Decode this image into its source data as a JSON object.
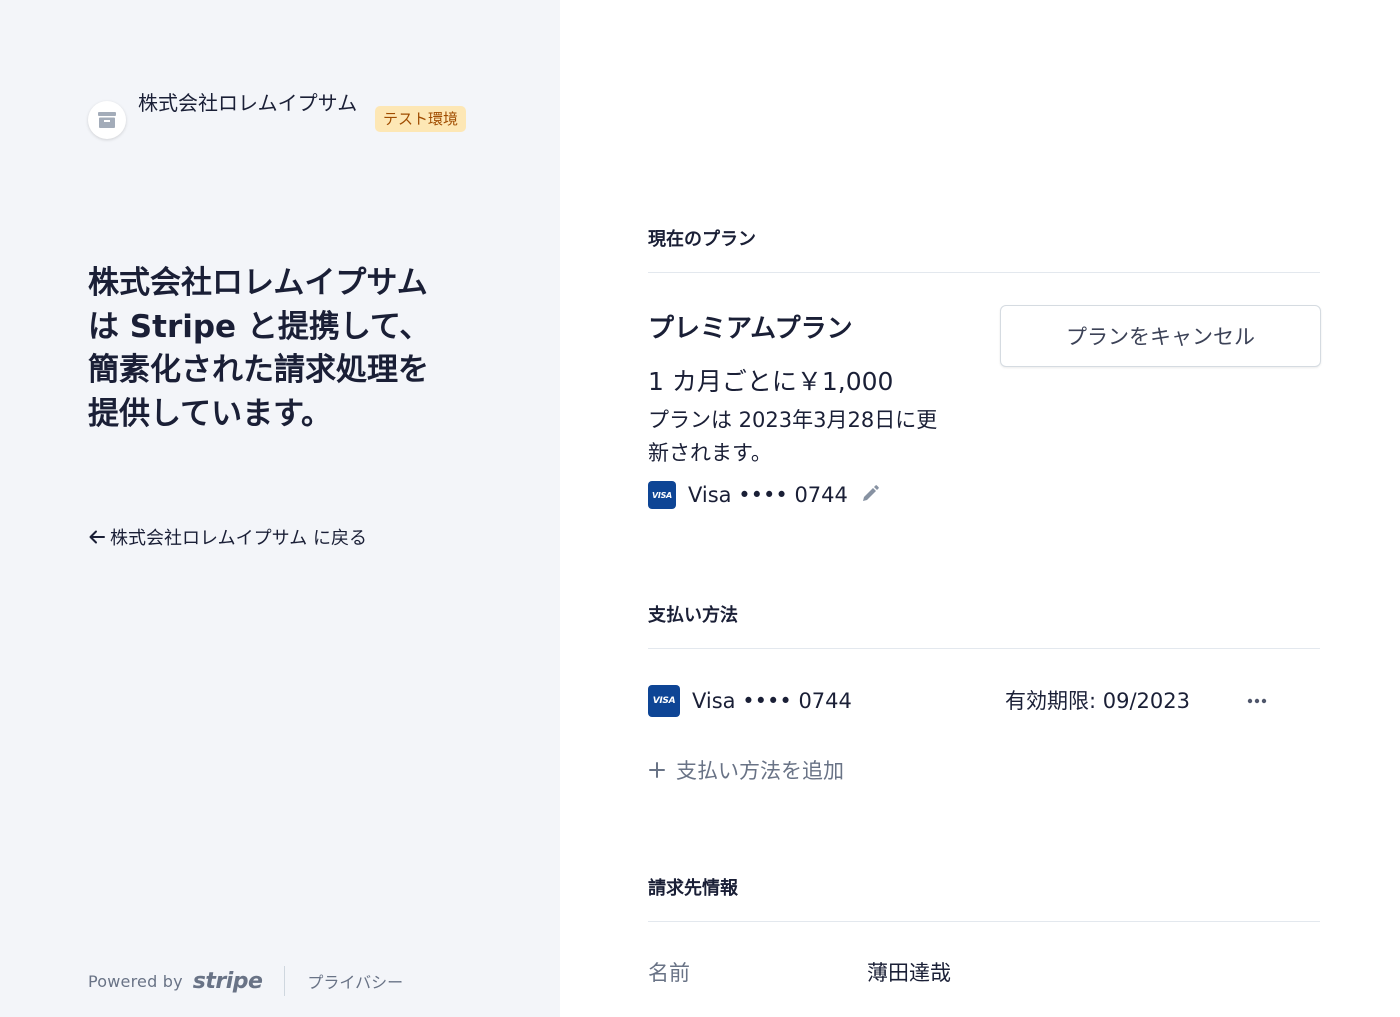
{
  "brand": {
    "name": "株式会社ロレムイプサム",
    "badge": "テスト環境"
  },
  "headline": "株式会社ロレムイプサム は Stripe と提携して、簡素化された請求処理を提供しています。",
  "back_link": "株式会社ロレムイプサム に戻る",
  "footer": {
    "powered_by": "Powered by",
    "stripe": "stripe",
    "privacy": "プライバシー"
  },
  "current_plan": {
    "section_title": "現在のプラン",
    "plan_name": "プレミアムプラン",
    "price": "1 カ月ごとに￥1,000",
    "renewal": "プランは 2023年3月28日に更新されます。",
    "card_brand_badge": "VISA",
    "card": "Visa •••• 0744",
    "cancel_button": "プランをキャンセル"
  },
  "payment_methods": {
    "section_title": "支払い方法",
    "items": [
      {
        "brand_badge": "VISA",
        "card": "Visa •••• 0744",
        "expiry": "有効期限: 09/2023"
      }
    ],
    "add_label": "支払い方法を追加"
  },
  "billing_info": {
    "section_title": "請求先情報",
    "name_label": "名前",
    "name_value": "薄田達哉"
  },
  "colors": {
    "left_panel_bg": "#f3f5f9",
    "badge_bg": "#fde7b5",
    "badge_text": "#a04c00",
    "visa_blue": "#0e4595",
    "muted_text": "#697386"
  }
}
